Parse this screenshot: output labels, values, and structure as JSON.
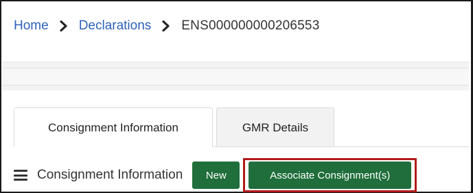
{
  "breadcrumb": {
    "home_label": "Home",
    "declarations_label": "Declarations",
    "current_label": "ENS000000000206553",
    "separator_icon": "chevron-right-icon"
  },
  "tabs": [
    {
      "label": "Consignment Information",
      "active": true
    },
    {
      "label": "GMR Details",
      "active": false
    }
  ],
  "section": {
    "menu_icon": "hamburger-menu-icon",
    "title": "Consignment Information",
    "new_button_label": "New",
    "associate_button_label": "Associate Consignment(s)"
  },
  "colors": {
    "link": "#2d62b8",
    "button_green": "#1f6e3b",
    "highlight_red": "#b11a1a"
  }
}
